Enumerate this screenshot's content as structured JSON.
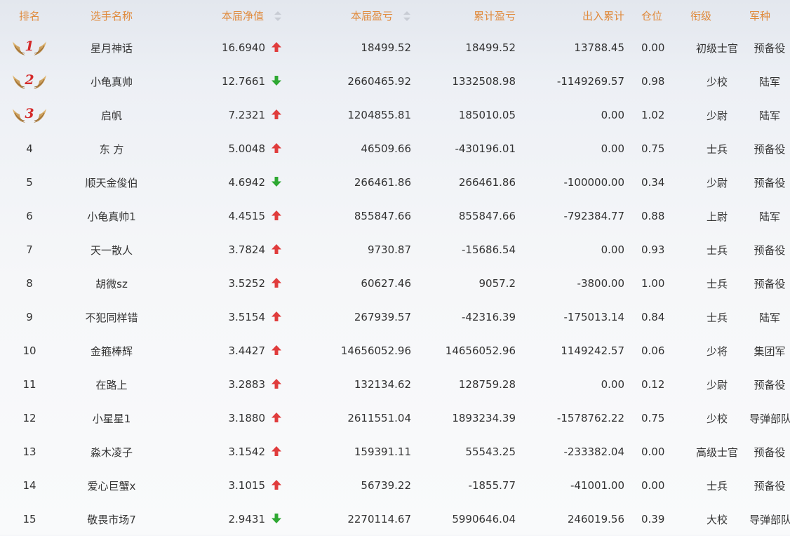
{
  "headers": {
    "rank": "排名",
    "name": "选手名称",
    "net_value": "本届净值",
    "profit": "本届盈亏",
    "total_profit": "累计盈亏",
    "flow": "出入累计",
    "position": "仓位",
    "title": "衔级",
    "branch": "军种"
  },
  "colors": {
    "header": "#e08a3c",
    "up": "#e03c3c",
    "down": "#2ea832",
    "medal_number": "#d42a2a"
  },
  "rows": [
    {
      "rank": "1",
      "medal": true,
      "name": "星月神话",
      "net_value": "16.6940",
      "trend": "up",
      "profit": "18499.52",
      "total_profit": "18499.52",
      "flow": "13788.45",
      "position": "0.00",
      "title": "初级士官",
      "branch": "预备役"
    },
    {
      "rank": "2",
      "medal": true,
      "name": "小龟真帅",
      "net_value": "12.7661",
      "trend": "down",
      "profit": "2660465.92",
      "total_profit": "1332508.98",
      "flow": "-1149269.57",
      "position": "0.98",
      "title": "少校",
      "branch": "陆军"
    },
    {
      "rank": "3",
      "medal": true,
      "name": "启帆",
      "net_value": "7.2321",
      "trend": "up",
      "profit": "1204855.81",
      "total_profit": "185010.05",
      "flow": "0.00",
      "position": "1.02",
      "title": "少尉",
      "branch": "陆军"
    },
    {
      "rank": "4",
      "medal": false,
      "name": "东 方",
      "net_value": "5.0048",
      "trend": "up",
      "profit": "46509.66",
      "total_profit": "-430196.01",
      "flow": "0.00",
      "position": "0.75",
      "title": "士兵",
      "branch": "预备役"
    },
    {
      "rank": "5",
      "medal": false,
      "name": "顺天金俊伯",
      "net_value": "4.6942",
      "trend": "down",
      "profit": "266461.86",
      "total_profit": "266461.86",
      "flow": "-100000.00",
      "position": "0.34",
      "title": "少尉",
      "branch": "预备役"
    },
    {
      "rank": "6",
      "medal": false,
      "name": "小龟真帅1",
      "net_value": "4.4515",
      "trend": "up",
      "profit": "855847.66",
      "total_profit": "855847.66",
      "flow": "-792384.77",
      "position": "0.88",
      "title": "上尉",
      "branch": "陆军"
    },
    {
      "rank": "7",
      "medal": false,
      "name": "天一散人",
      "net_value": "3.7824",
      "trend": "up",
      "profit": "9730.87",
      "total_profit": "-15686.54",
      "flow": "0.00",
      "position": "0.93",
      "title": "士兵",
      "branch": "预备役"
    },
    {
      "rank": "8",
      "medal": false,
      "name": "胡微sz",
      "net_value": "3.5252",
      "trend": "up",
      "profit": "60627.46",
      "total_profit": "9057.2",
      "flow": "-3800.00",
      "position": "1.00",
      "title": "士兵",
      "branch": "预备役"
    },
    {
      "rank": "9",
      "medal": false,
      "name": "不犯同样错",
      "net_value": "3.5154",
      "trend": "up",
      "profit": "267939.57",
      "total_profit": "-42316.39",
      "flow": "-175013.14",
      "position": "0.84",
      "title": "士兵",
      "branch": "陆军"
    },
    {
      "rank": "10",
      "medal": false,
      "name": "金箍棒辉",
      "net_value": "3.4427",
      "trend": "up",
      "profit": "14656052.96",
      "total_profit": "14656052.96",
      "flow": "1149242.57",
      "position": "0.06",
      "title": "少将",
      "branch": "集团军"
    },
    {
      "rank": "11",
      "medal": false,
      "name": "在路上",
      "net_value": "3.2883",
      "trend": "up",
      "profit": "132134.62",
      "total_profit": "128759.28",
      "flow": "0.00",
      "position": "0.12",
      "title": "少尉",
      "branch": "预备役"
    },
    {
      "rank": "12",
      "medal": false,
      "name": "小星星1",
      "net_value": "3.1880",
      "trend": "up",
      "profit": "2611551.04",
      "total_profit": "1893234.39",
      "flow": "-1578762.22",
      "position": "0.75",
      "title": "少校",
      "branch": "导弹部队"
    },
    {
      "rank": "13",
      "medal": false,
      "name": "淼木凌子",
      "net_value": "3.1542",
      "trend": "up",
      "profit": "159391.11",
      "total_profit": "55543.25",
      "flow": "-233382.04",
      "position": "0.00",
      "title": "高级士官",
      "branch": "预备役"
    },
    {
      "rank": "14",
      "medal": false,
      "name": "爱心巨蟹x",
      "net_value": "3.1015",
      "trend": "up",
      "profit": "56739.22",
      "total_profit": "-1855.77",
      "flow": "-41001.00",
      "position": "0.00",
      "title": "士兵",
      "branch": "预备役"
    },
    {
      "rank": "15",
      "medal": false,
      "name": "敬畏市场7",
      "net_value": "2.9431",
      "trend": "down",
      "profit": "2270114.67",
      "total_profit": "5990646.04",
      "flow": "246019.56",
      "position": "0.39",
      "title": "大校",
      "branch": "导弹部队"
    }
  ]
}
